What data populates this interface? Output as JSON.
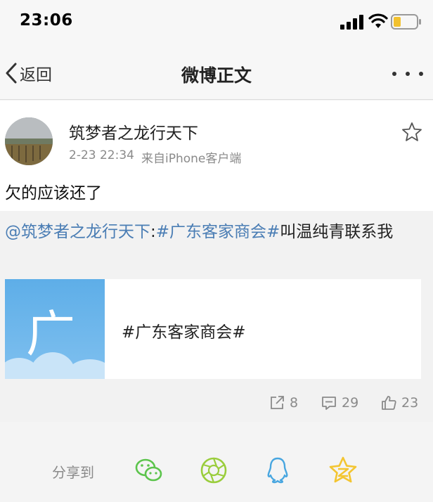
{
  "status_bar": {
    "time": "23:06"
  },
  "nav": {
    "back_label": "返回",
    "title": "微博正文"
  },
  "post": {
    "author": "筑梦者之龙行天下",
    "date": "2-23 22:34",
    "source": "来自iPhone客户端",
    "text": "欠的应该还了"
  },
  "repost": {
    "mention": "@筑梦者之龙行天下",
    "colon": ":",
    "topic": "#广东客家商会#",
    "rest": "叫温纯青联系我",
    "card": {
      "thumb_glyph": "广",
      "title": "#广东客家商会#"
    },
    "stats": {
      "reposts": "8",
      "comments": "29",
      "likes": "23"
    }
  },
  "share": {
    "label": "分享到",
    "icons": [
      "wechat-icon",
      "moments-icon",
      "qq-icon",
      "qzone-icon"
    ],
    "colors": {
      "wechat": "#5cc44c",
      "moments": "#9acd3c",
      "qq": "#48a6e0",
      "qzone": "#f3c531"
    }
  },
  "colors": {
    "link": "#4a7db4",
    "meta": "#8a8a8a"
  }
}
